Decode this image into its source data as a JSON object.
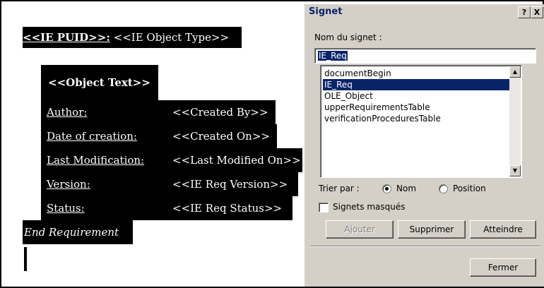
{
  "document": {
    "header_puid": "<<IE PUID>>:",
    "header_type": " <<IE Object Type>>",
    "object_text": "<<Object Text>>",
    "rows": [
      {
        "label": "Author:",
        "value": "<<Created By>>"
      },
      {
        "label": "Date of creation:",
        "value": "<<Created On>>"
      },
      {
        "label": "Last Modification:",
        "value": "<<Last Modified On>>"
      },
      {
        "label": "Version:",
        "value": "<<IE Req Version>>"
      },
      {
        "label": "Status:",
        "value": "<<IE Req Status>>"
      }
    ],
    "end_text": "End Requirement"
  },
  "dialog": {
    "title": "Signet",
    "help_button": "?",
    "close_button": "X",
    "name_label": "Nom du signet :",
    "name_value": "IE_Req",
    "bookmarks": [
      "documentBegin",
      "IE_Req",
      "OLE_Object",
      "upperRequirementsTable",
      "verificationProceduresTable"
    ],
    "selected_bookmark": "IE_Req",
    "sort_label": "Trier par :",
    "sort_options": [
      "Nom",
      "Position"
    ],
    "sort_selected": "Nom",
    "hidden_label": "Signets masqués",
    "hidden_checked": false,
    "buttons": {
      "add": "Ajouter",
      "delete": "Supprimer",
      "goto": "Atteindre",
      "close": "Fermer"
    },
    "add_enabled": false
  }
}
